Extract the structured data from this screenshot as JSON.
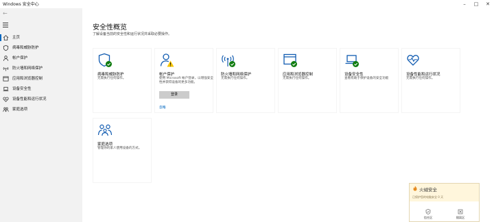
{
  "window": {
    "title": "Windows 安全中心",
    "controls": {
      "minimize": "–",
      "maximize": "□",
      "close": "✕"
    }
  },
  "sidebar": {
    "back_label": "←",
    "items": [
      {
        "label": "主页",
        "icon": "home-icon",
        "active": true
      },
      {
        "label": "病毒和威胁防护",
        "icon": "shield-icon"
      },
      {
        "label": "帐户保护",
        "icon": "person-icon"
      },
      {
        "label": "防火墙和网络保护",
        "icon": "wifi-icon"
      },
      {
        "label": "应用和浏览器控制",
        "icon": "app-window-icon"
      },
      {
        "label": "设备安全性",
        "icon": "laptop-icon"
      },
      {
        "label": "设备性能和运行状况",
        "icon": "heart-pulse-icon"
      },
      {
        "label": "家庭选项",
        "icon": "family-icon"
      }
    ]
  },
  "main": {
    "title": "安全性概览",
    "subtitle": "了解设备当前的安全性和运行状况并采取必要操作。",
    "tiles": [
      {
        "title": "病毒和威胁防护",
        "desc": "无需执行任何操作。",
        "icon": "shield-check-icon",
        "status": "ok"
      },
      {
        "title": "帐户保护",
        "desc": "使用 Microsoft 帐户登录，以增强安全性并获得设备的更多功能。",
        "icon": "person-warning-icon",
        "status": "warning",
        "button": "登录",
        "link": "忽略"
      },
      {
        "title": "防火墙和网络保护",
        "desc": "无需执行任何操作。",
        "icon": "wifi-check-icon",
        "status": "ok"
      },
      {
        "title": "应用和浏览器控制",
        "desc": "无需执行任何操作。",
        "icon": "app-window-check-icon",
        "status": "ok"
      },
      {
        "title": "设备安全性",
        "desc": "查看有助于保护设备的安全功能",
        "icon": "laptop-check-icon",
        "status": "ok"
      },
      {
        "title": "设备性能和运行状况",
        "desc": "无需执行任何操作。",
        "icon": "heart-pulse-icon",
        "status": "none"
      },
      {
        "title": "家庭选项",
        "desc": "管理你的家人使用设备的方式。",
        "icon": "family-icon",
        "status": "none"
      }
    ]
  },
  "popup": {
    "title": "火绒安全",
    "message": "已保护您的电脑安全 0 天",
    "actions": [
      {
        "label": "信任区",
        "icon": "trust-zone-icon"
      },
      {
        "label": "隔离区",
        "icon": "quarantine-icon"
      }
    ]
  },
  "colors": {
    "accent": "#0067c0",
    "ok_green": "#107c10",
    "warning_yellow": "#f5c400",
    "icon_blue": "#0f5ab0",
    "sidebar_bg": "#f2f2f2",
    "popup_bg": "#fff6dc"
  }
}
